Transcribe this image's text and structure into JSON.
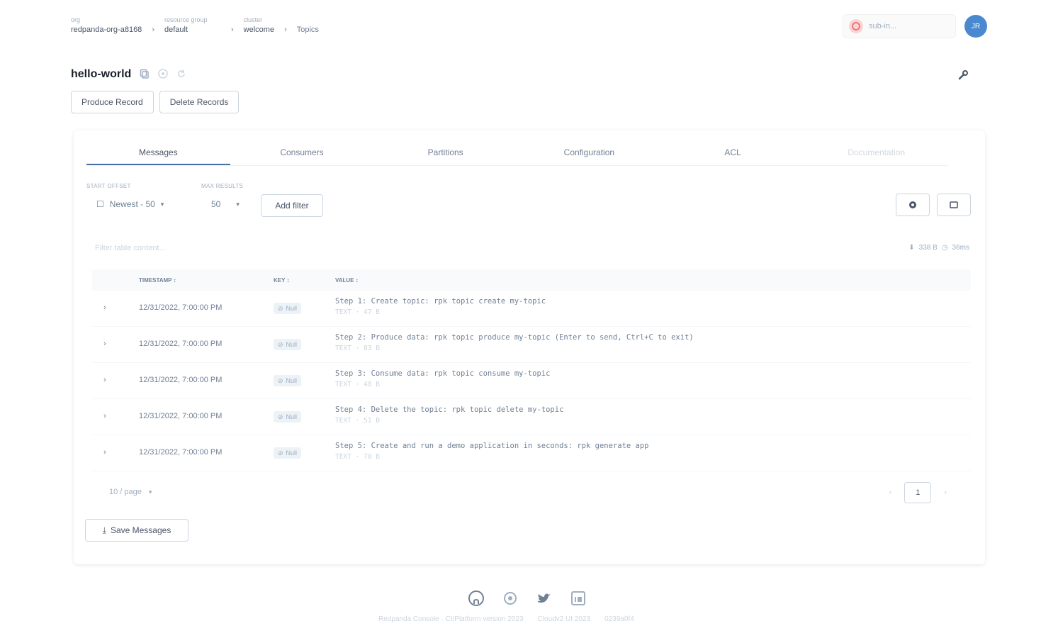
{
  "breadcrumb": [
    {
      "caption": "org",
      "value": "redpanda-org-a8168"
    },
    {
      "caption": "resource group",
      "value": "default"
    },
    {
      "caption": "cluster",
      "value": "welcome"
    }
  ],
  "breadcrumb_last": "Topics",
  "breadcrumb_sep": "›",
  "cluster_selector": {
    "name": "sub-in..."
  },
  "avatar": {
    "initials": "JR",
    "color": "#4a88d0"
  },
  "page": {
    "title": "hello-world"
  },
  "actions": {
    "produce": "Produce Record",
    "delete": "Delete Records"
  },
  "tabs": [
    {
      "label": "Messages",
      "active": true
    },
    {
      "label": "Consumers"
    },
    {
      "label": "Partitions"
    },
    {
      "label": "Configuration"
    },
    {
      "label": "ACL"
    },
    {
      "label": "Documentation",
      "disabled": true
    }
  ],
  "controls": {
    "start_offset_label": "Start Offset",
    "start_offset_value": "Newest - 50",
    "max_results_label": "Max Results",
    "max_results_value": "50",
    "add_filter": "Add filter"
  },
  "filter_placeholder": "Filter table content...",
  "stats": {
    "bytes": "338 B",
    "time": "36ms"
  },
  "table": {
    "headers": {
      "timestamp": "Timestamp",
      "key": "Key",
      "value": "Value"
    },
    "rows": [
      {
        "timestamp": "12/31/2022, 7:00:00 PM",
        "key": "Null",
        "value": "Step 1: Create topic: rpk topic create my-topic",
        "meta": "TEXT · 47 B"
      },
      {
        "timestamp": "12/31/2022, 7:00:00 PM",
        "key": "Null",
        "value": "Step 2: Produce data: rpk topic produce my-topic (Enter to send, Ctrl+C to exit)",
        "meta": "TEXT · 83 B"
      },
      {
        "timestamp": "12/31/2022, 7:00:00 PM",
        "key": "Null",
        "value": "Step 3: Consume data: rpk topic consume my-topic",
        "meta": "TEXT · 48 B"
      },
      {
        "timestamp": "12/31/2022, 7:00:00 PM",
        "key": "Null",
        "value": "Step 4: Delete the topic: rpk topic delete my-topic",
        "meta": "TEXT · 51 B"
      },
      {
        "timestamp": "12/31/2022, 7:00:00 PM",
        "key": "Null",
        "value": "Step 5: Create and run a demo application in seconds: rpk generate app",
        "meta": "TEXT · 70 B"
      }
    ]
  },
  "pagination": {
    "page_size": "10 / page",
    "current_page": "1"
  },
  "save_button": "Save Messages",
  "footer": {
    "links": [
      "Redpanda Console · CI/Platform version 2023",
      "Cloudv2 UI 2023",
      "0239a0f4"
    ]
  },
  "icons": {
    "copy": "copy-icon",
    "info": "info-icon",
    "refresh": "refresh-icon",
    "wrench": "wrench-icon",
    "settings": "gear-icon",
    "reload": "reload-icon",
    "github": "github-icon",
    "slack": "slack-icon",
    "twitter": "twitter-icon",
    "linkedin": "linkedin-icon"
  }
}
